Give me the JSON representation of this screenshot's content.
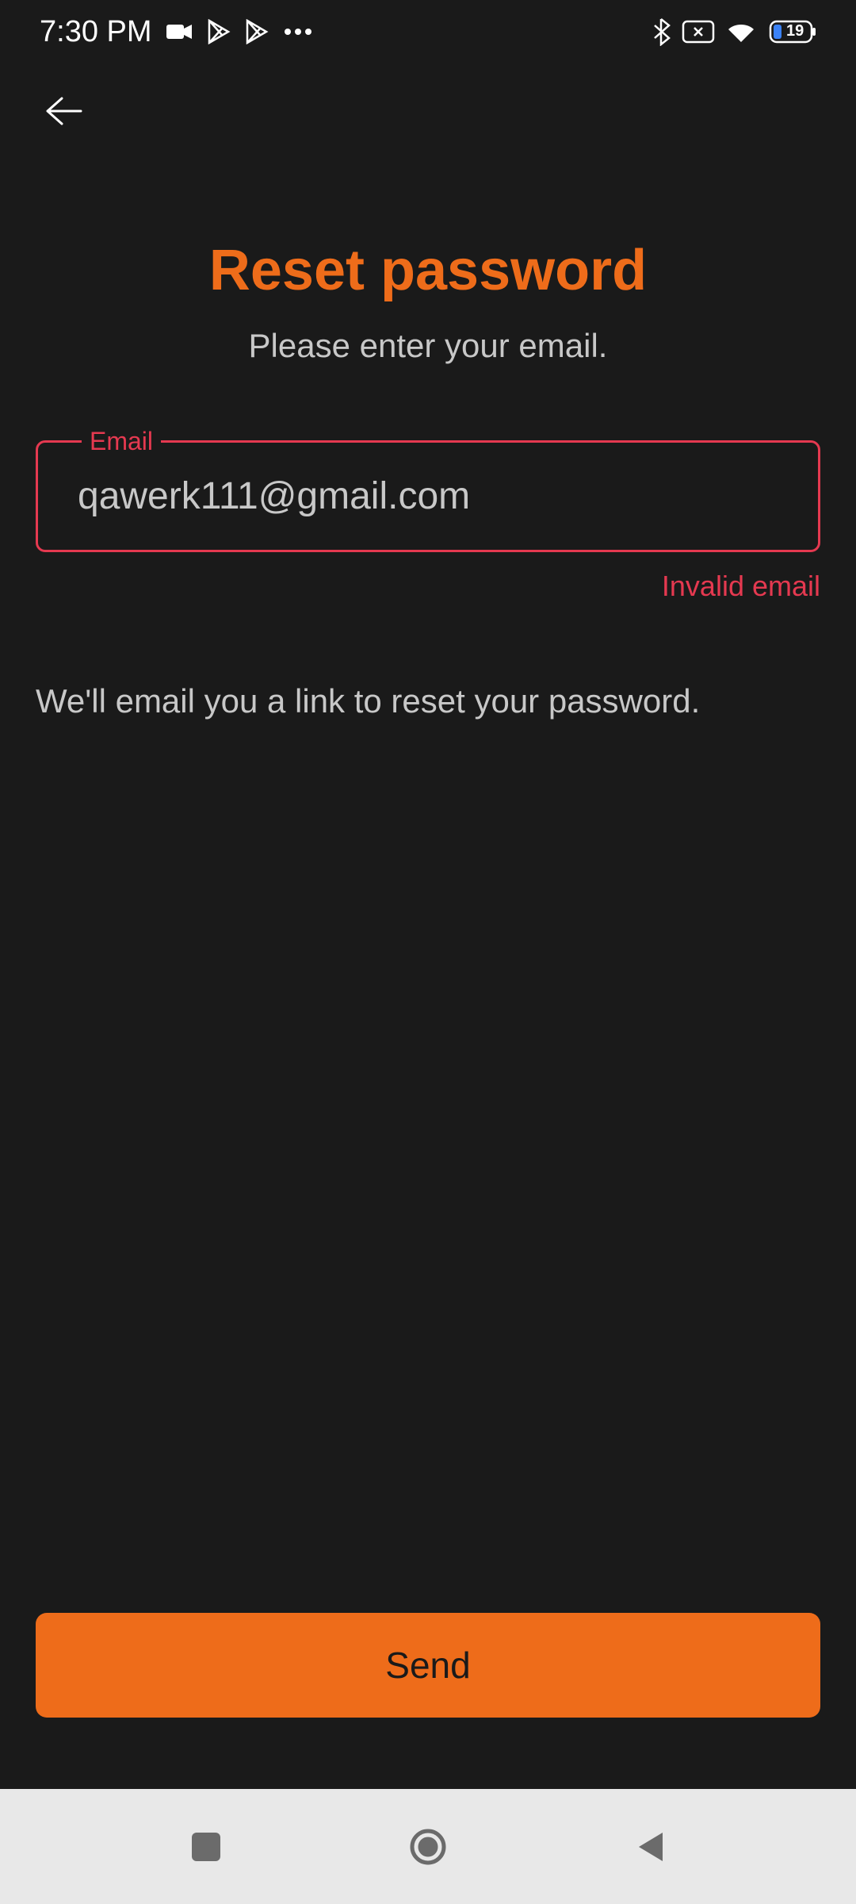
{
  "statusBar": {
    "time": "7:30 PM",
    "batteryLevel": "19"
  },
  "page": {
    "title": "Reset password",
    "subtitle": "Please enter your email.",
    "helperText": "We'll email you a link to reset your password."
  },
  "emailField": {
    "label": "Email",
    "value": "qawerk111@gmail.com",
    "error": "Invalid email"
  },
  "sendButton": {
    "label": "Send"
  },
  "colors": {
    "accent": "#ee6c1a",
    "error": "#e53950",
    "bg": "#1a1a1a",
    "text": "#c8c8c8"
  }
}
